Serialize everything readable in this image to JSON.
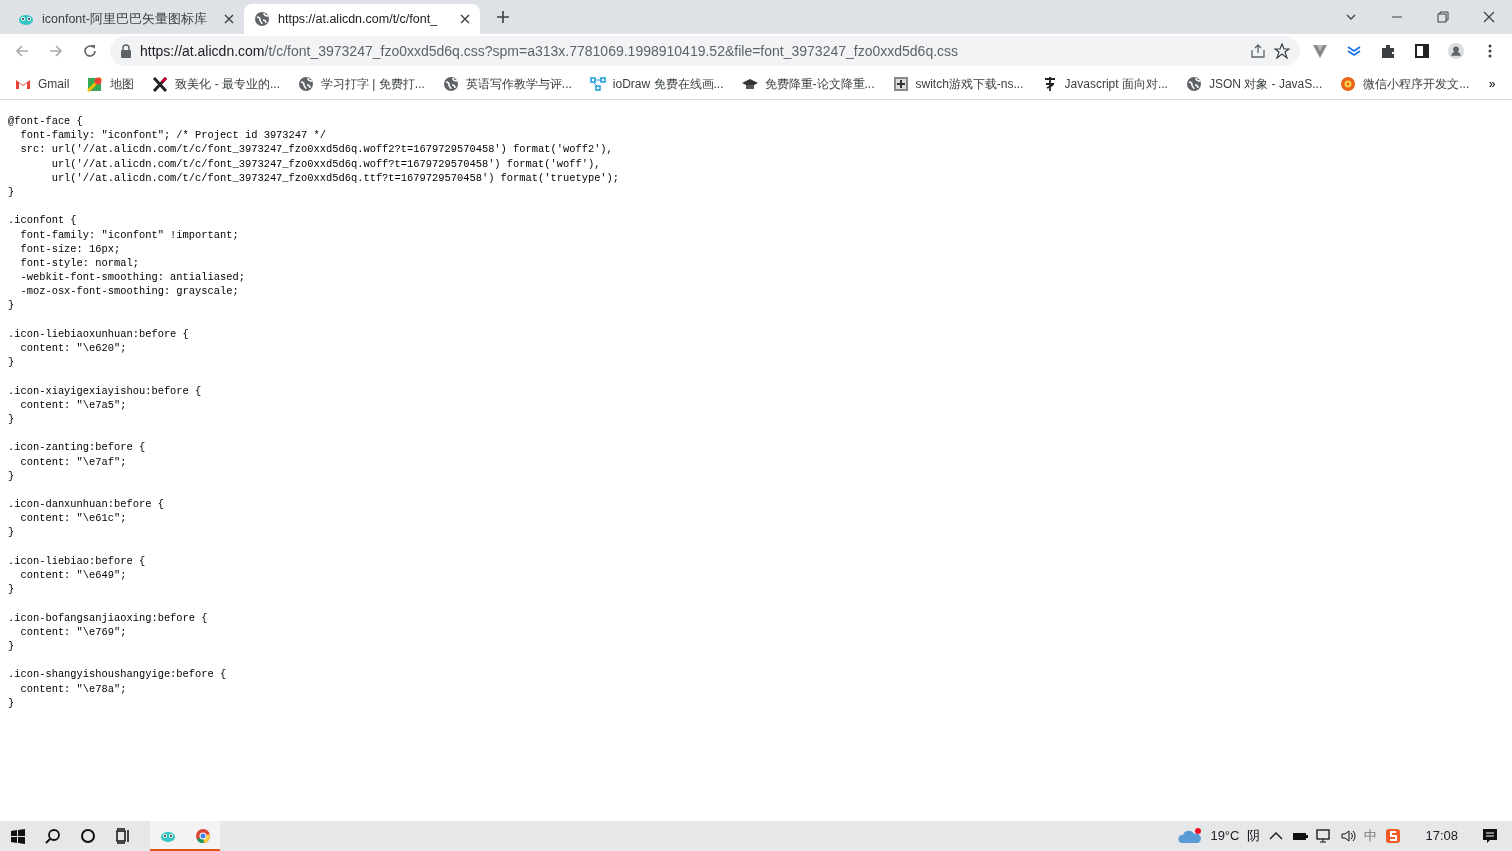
{
  "tabs": [
    {
      "title": "iconfont-阿里巴巴矢量图标库",
      "kind": "iconfont",
      "selected": false
    },
    {
      "title": "https://at.alicdn.com/t/c/font_",
      "kind": "globe",
      "selected": true
    }
  ],
  "address_bar": {
    "host": "https://at.alicdn.com",
    "path": "/t/c/font_3973247_fzo0xxd5d6q.css?spm=a313x.7781069.1998910419.52&file=font_3973247_fzo0xxd5d6q.css"
  },
  "bookmarks": [
    {
      "label": "Gmail",
      "kind": "gmail"
    },
    {
      "label": "地图",
      "kind": "map"
    },
    {
      "label": "致美化 - 最专业的...",
      "kind": "x"
    },
    {
      "label": "学习打字 | 免费打...",
      "kind": "globe"
    },
    {
      "label": "英语写作教学与评...",
      "kind": "globe"
    },
    {
      "label": "ioDraw 免费在线画...",
      "kind": "flow"
    },
    {
      "label": "免费降重-论文降重...",
      "kind": "cap"
    },
    {
      "label": "switch游戏下载-ns...",
      "kind": "game"
    },
    {
      "label": "Javascript 面向对...",
      "kind": "brush"
    },
    {
      "label": "JSON 对象 - JavaS...",
      "kind": "globe"
    },
    {
      "label": "微信小程序开发文...",
      "kind": "flower"
    }
  ],
  "bookmarks_more": "»",
  "code_blocks": [
    [
      "@font-face {",
      "  font-family: \"iconfont\"; /* Project id 3973247 */",
      "  src: url('//at.alicdn.com/t/c/font_3973247_fzo0xxd5d6q.woff2?t=1679729570458') format('woff2'),",
      "       url('//at.alicdn.com/t/c/font_3973247_fzo0xxd5d6q.woff?t=1679729570458') format('woff'),",
      "       url('//at.alicdn.com/t/c/font_3973247_fzo0xxd5d6q.ttf?t=1679729570458') format('truetype');",
      "}"
    ],
    [
      ".iconfont {",
      "  font-family: \"iconfont\" !important;",
      "  font-size: 16px;",
      "  font-style: normal;",
      "  -webkit-font-smoothing: antialiased;",
      "  -moz-osx-font-smoothing: grayscale;",
      "}"
    ],
    [
      ".icon-liebiaoxunhuan:before {",
      "  content: \"\\e620\";",
      "}"
    ],
    [
      ".icon-xiayigexiayishou:before {",
      "  content: \"\\e7a5\";",
      "}"
    ],
    [
      ".icon-zanting:before {",
      "  content: \"\\e7af\";",
      "}"
    ],
    [
      ".icon-danxunhuan:before {",
      "  content: \"\\e61c\";",
      "}"
    ],
    [
      ".icon-liebiao:before {",
      "  content: \"\\e649\";",
      "}"
    ],
    [
      ".icon-bofangsanjiaoxing:before {",
      "  content: \"\\e769\";",
      "}"
    ],
    [
      ".icon-shangyishoushangyige:before {",
      "  content: \"\\e78a\";",
      "}"
    ]
  ],
  "taskbar": {
    "apps": [
      {
        "kind": "iconfont",
        "active": true
      },
      {
        "kind": "browser",
        "active": true
      }
    ],
    "weather": {
      "temperature": "19°C",
      "condition": "阴"
    },
    "ime": "中",
    "time": "17:08"
  }
}
